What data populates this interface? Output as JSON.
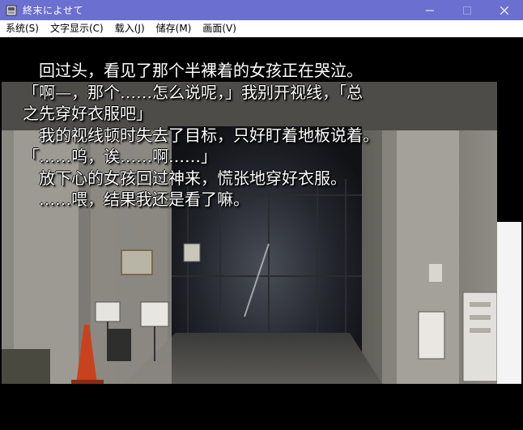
{
  "window": {
    "title": "終末によせて",
    "icon": "app-icon",
    "controls": [
      "minimize-icon",
      "maximize-icon",
      "close-icon"
    ]
  },
  "menu": {
    "items": [
      {
        "label": "系统(S)"
      },
      {
        "label": "文字显示(C)"
      },
      {
        "label": "载入(J)"
      },
      {
        "label": "储存(M)"
      },
      {
        "label": "画面(V)"
      }
    ]
  },
  "dialogue": {
    "lines": [
      "　回过头，看见了那个半裸着的女孩正在哭泣。",
      "「啊—，那个……怎么说呢，」我别开视线，「总",
      "之先穿好衣服吧」",
      "　我的视线顿时失去了目标，只好盯着地板说着。",
      "「……呜，诶……啊……」",
      "　放下心的女孩回过神来，慌张地穿好衣服。",
      "　……喂，结果我还是看了嘛。"
    ]
  },
  "scene": {
    "signs": {
      "left_panel": "",
      "right_small": "",
      "right_board": ""
    }
  },
  "colors": {
    "titlebar": "#6b6fd0",
    "menubar": "#ffffff",
    "text": "#ffffff"
  }
}
